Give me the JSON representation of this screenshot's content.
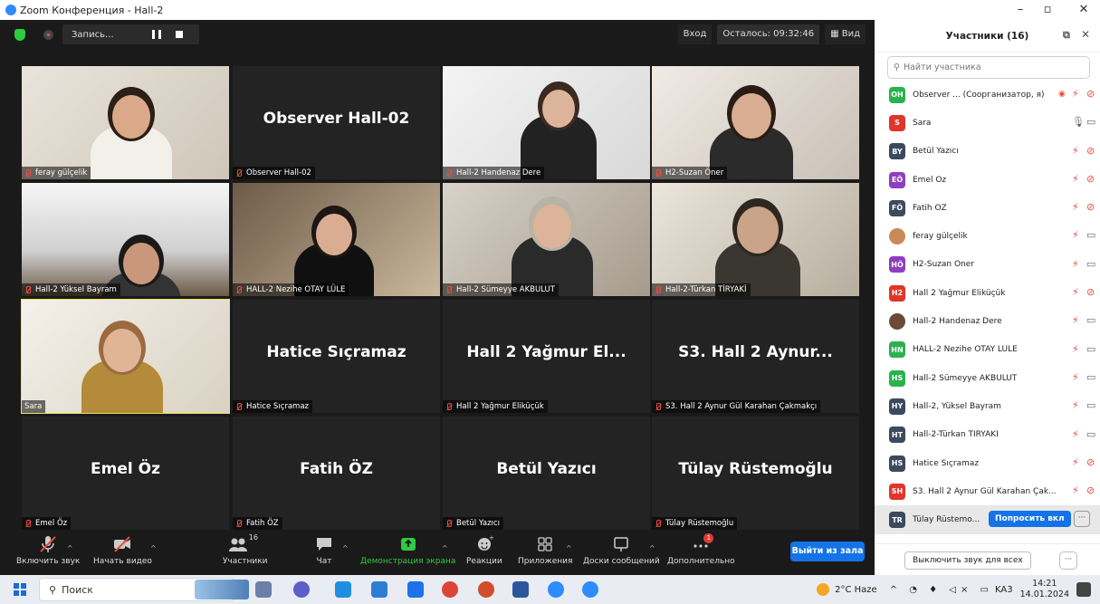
{
  "window": {
    "title": "Zoom Конференция - Hall-2"
  },
  "topbar": {
    "record_label": "Запись...",
    "enter_label": "Вход",
    "timer": "Осталось: 09:32:46",
    "view_label": "Вид"
  },
  "tiles": [
    {
      "name": "feray gülçelik",
      "big": "",
      "video": true
    },
    {
      "name": "Observer  Hall-02",
      "big": "Observer  Hall-02",
      "video": false
    },
    {
      "name": "Hall-2 Handenaz Dere",
      "big": "",
      "video": true
    },
    {
      "name": "H2-Suzan Öner",
      "big": "",
      "video": true
    },
    {
      "name": "Hall-2 Yüksel Bayram",
      "big": "",
      "video": true
    },
    {
      "name": "HALL-2 Nezihe OTAY LÜLE",
      "big": "",
      "video": true
    },
    {
      "name": "Hall-2 Sümeyye AKBULUT",
      "big": "",
      "video": true
    },
    {
      "name": "Hall-2-Türkan TİRYAKİ",
      "big": "",
      "video": true
    },
    {
      "name": "Sara",
      "big": "",
      "video": true
    },
    {
      "name": "Hatice Sıçramaz",
      "big": "Hatice Sıçramaz",
      "video": false
    },
    {
      "name": "Hall 2 Yağmur Eliküçük",
      "big": "Hall 2 Yağmur El...",
      "video": false
    },
    {
      "name": "S3. Hall 2 Aynur Gül Karahan Çakmakçı",
      "big": "S3. Hall 2 Aynur...",
      "video": false
    },
    {
      "name": "Emel Öz",
      "big": "Emel Öz",
      "video": false
    },
    {
      "name": "Fatih ÖZ",
      "big": "Fatih ÖZ",
      "video": false
    },
    {
      "name": "Betül Yazıcı",
      "big": "Betül Yazıcı",
      "video": false
    },
    {
      "name": "Tülay Rüstemoğlu",
      "big": "Tülay Rüstemoğlu",
      "video": false
    }
  ],
  "toolbar": {
    "unmute": "Включить звук",
    "start_video": "Начать видео",
    "participants": "Участники",
    "participants_count": "16",
    "chat": "Чат",
    "share": "Демонстрация экрана",
    "reactions": "Реакции",
    "apps": "Приложения",
    "whiteboards": "Доски сообщений",
    "more": "Дополнительно",
    "more_badge": "1",
    "leave": "Выйти из зала"
  },
  "panel": {
    "title": "Участники (16)",
    "search_placeholder": "Найти участника",
    "participants": [
      {
        "initials": "OH",
        "color": "#2bb24c",
        "name": "Observer ... (Соорганизатор, я)"
      },
      {
        "initials": "S",
        "color": "#e0352b",
        "name": "Sara"
      },
      {
        "initials": "BY",
        "color": "#3c4a5e",
        "name": "Betül Yazıcı"
      },
      {
        "initials": "EÖ",
        "color": "#8e3fbf",
        "name": "Emel Öz"
      },
      {
        "initials": "FÖ",
        "color": "#3c4a5e",
        "name": "Fatih ÖZ"
      },
      {
        "initials": "",
        "color": "#c98a5a",
        "name": "feray gülçelik"
      },
      {
        "initials": "HÖ",
        "color": "#8e3fbf",
        "name": "H2-Suzan Öner"
      },
      {
        "initials": "H2",
        "color": "#e0352b",
        "name": "Hall 2 Yağmur Eliküçük"
      },
      {
        "initials": "",
        "color": "#6b4a36",
        "name": "Hall-2 Handenaz Dere"
      },
      {
        "initials": "HN",
        "color": "#2bb24c",
        "name": "HALL-2 Nezihe OTAY LÜLE"
      },
      {
        "initials": "HS",
        "color": "#2bb24c",
        "name": "Hall-2 Sümeyye AKBULUT"
      },
      {
        "initials": "HY",
        "color": "#3c4a5e",
        "name": "Hall-2, Yüksel Bayram"
      },
      {
        "initials": "HT",
        "color": "#3c4a5e",
        "name": "Hall-2-Türkan TİRYAKİ"
      },
      {
        "initials": "HS",
        "color": "#3c4a5e",
        "name": "Hatice Sıçramaz"
      },
      {
        "initials": "SH",
        "color": "#e0352b",
        "name": "S3. Hall 2 Aynur Gül Karahan Çak..."
      },
      {
        "initials": "TR",
        "color": "#3c4a5e",
        "name": "Tülay Rüstemo..."
      }
    ],
    "ask_unmute": "Попросить вкл",
    "mute_all": "Выключить звук для всех"
  },
  "taskbar": {
    "search": "Поиск",
    "weather": "2°C Haze",
    "lang": "KA3",
    "time": "14:21",
    "date": "14.01.2024"
  }
}
